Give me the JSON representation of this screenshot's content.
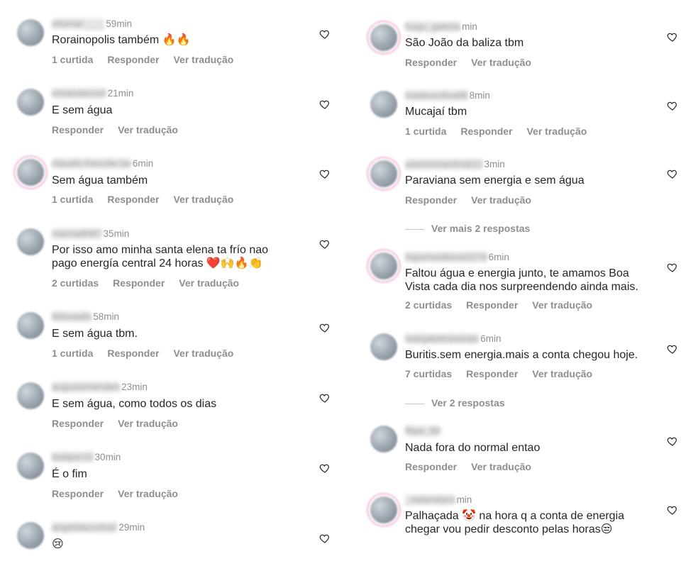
{
  "left": [
    {
      "user": "eliomar____",
      "time": "59min",
      "text": "Rorainopolis também 🔥🔥",
      "likes": "1 curtida",
      "reply": "Responder",
      "translate": "Ver tradução",
      "story": false
    },
    {
      "user": "elisandaros0",
      "time": "21min",
      "text": "E sem água",
      "likes": "",
      "reply": "Responder",
      "translate": "Ver tradução",
      "story": false
    },
    {
      "user": "claudio.francilei.be",
      "time": "6min",
      "text": "Sem água também",
      "likes": "1 curtida",
      "reply": "Responder",
      "translate": "Ver tradução",
      "story": true
    },
    {
      "user": "marcia8087",
      "time": "35min",
      "text": "Por isso amo minha santa elena ta frío nao pago energía central 24 horas ❤️🙌🔥👏",
      "likes": "2 curtidas",
      "reply": "Responder",
      "translate": "Ver tradução",
      "story": false
    },
    {
      "user": "feliosadis",
      "time": "58min",
      "text": "E sem água tbm.",
      "likes": "1 curtida",
      "reply": "Responder",
      "translate": "Ver tradução",
      "story": false
    },
    {
      "user": "augustomendes",
      "time": "23min",
      "text": "E sem água, como todos os dias",
      "likes": "",
      "reply": "Responder",
      "translate": "Ver tradução",
      "story": false
    },
    {
      "user": "lealiper10",
      "time": "30min",
      "text": "É o fim",
      "likes": "",
      "reply": "Responder",
      "translate": "Ver tradução",
      "story": false
    },
    {
      "user": "angeldacunha2",
      "time": "29min",
      "text": "😢",
      "likes": "",
      "reply": "",
      "translate": "",
      "story": false
    }
  ],
  "right": [
    {
      "user": "hugo_galeria",
      "time": "min",
      "text": "São João da baliza tbm",
      "likes": "",
      "reply": "Responder",
      "translate": "Ver tradução",
      "story": true
    },
    {
      "user": "madeuroliva88",
      "time": "8min",
      "text": "Mucajaí tbm",
      "likes": "1 curtida",
      "reply": "Responder",
      "translate": "Ver tradução",
      "story": false
    },
    {
      "user": "yasminmartinsb12",
      "time": "3min",
      "text": "Paraviana sem energia e sem água",
      "likes": "",
      "reply": "Responder",
      "translate": "Ver tradução",
      "story": true
    },
    {
      "user": "higormedeiros0278",
      "time": "6min",
      "text": "Faltou água e energia junto, te amamos Boa Vista cada dia nos surpreendendo ainda mais.",
      "likes": "2 curtidas",
      "reply": "Responder",
      "translate": "Ver tradução",
      "story": true
    },
    {
      "user": "margaketrasorais",
      "time": "6min",
      "text": "Buritis.sem energia.mais a conta chegou hoje.",
      "likes": "7 curtidas",
      "reply": "Responder",
      "translate": "Ver tradução",
      "story": false
    },
    {
      "user": "filipe_80",
      "time": "",
      "text": "Nada fora do normal entao",
      "likes": "",
      "reply": "Responder",
      "translate": "Ver tradução",
      "story": false
    },
    {
      "user": "_natanelyro",
      "time": "min",
      "text": "Palhaçada 🤡 na hora q a conta de energia chegar vou pedir desconto pelas horas😒",
      "likes": "",
      "reply": "",
      "translate": "",
      "story": true
    }
  ],
  "more_replies": [
    {
      "label": "Ver mais 2 respostas"
    },
    {
      "label": "Ver 2 respostas"
    }
  ],
  "icons": {
    "like": "heart-outline-icon"
  }
}
